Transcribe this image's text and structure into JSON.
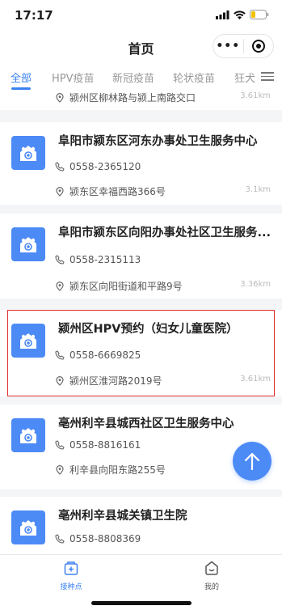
{
  "status_bar": {
    "time": "17:17"
  },
  "nav": {
    "title": "首页",
    "more_glyph": "•••"
  },
  "tabs": [
    {
      "label": "全部",
      "active": true
    },
    {
      "label": "HPV疫苗",
      "active": false
    },
    {
      "label": "新冠疫苗",
      "active": false
    },
    {
      "label": "轮状疫苗",
      "active": false
    },
    {
      "label": "狂犬",
      "active": false
    }
  ],
  "list": {
    "partial_top": {
      "address": "颍州区柳林路与颍上南路交口",
      "distance": "3.61km"
    },
    "items": [
      {
        "name": "阜阳市颍东区河东办事处卫生服务中心",
        "phone": "0558-2365120",
        "address": "颍东区幸福西路366号",
        "distance": "3.1km"
      },
      {
        "name": "阜阳市颍东区向阳办事处社区卫生服务...",
        "phone": "0558-2315113",
        "address": "颍东区向阳街道和平路9号",
        "distance": "3.36km"
      },
      {
        "name": "颍州区HPV预约（妇女儿童医院）",
        "phone": "0558-6669825",
        "address": "颍州区淮河路2019号",
        "distance": "3.61km"
      },
      {
        "name": "亳州利辛县城西社区卫生服务中心",
        "phone": "0558-8816161",
        "address": "利辛县向阳东路255号",
        "distance": ""
      },
      {
        "name": "亳州利辛县城关镇卫生院",
        "phone": "0558-8808369",
        "address": "",
        "distance": ""
      }
    ]
  },
  "tabbar": {
    "items": [
      {
        "label": "接种点",
        "active": true
      },
      {
        "label": "我的",
        "active": false
      }
    ]
  },
  "colors": {
    "accent": "#3d82f2",
    "icon_bg": "#4c8af6",
    "highlight": "#e03030"
  }
}
